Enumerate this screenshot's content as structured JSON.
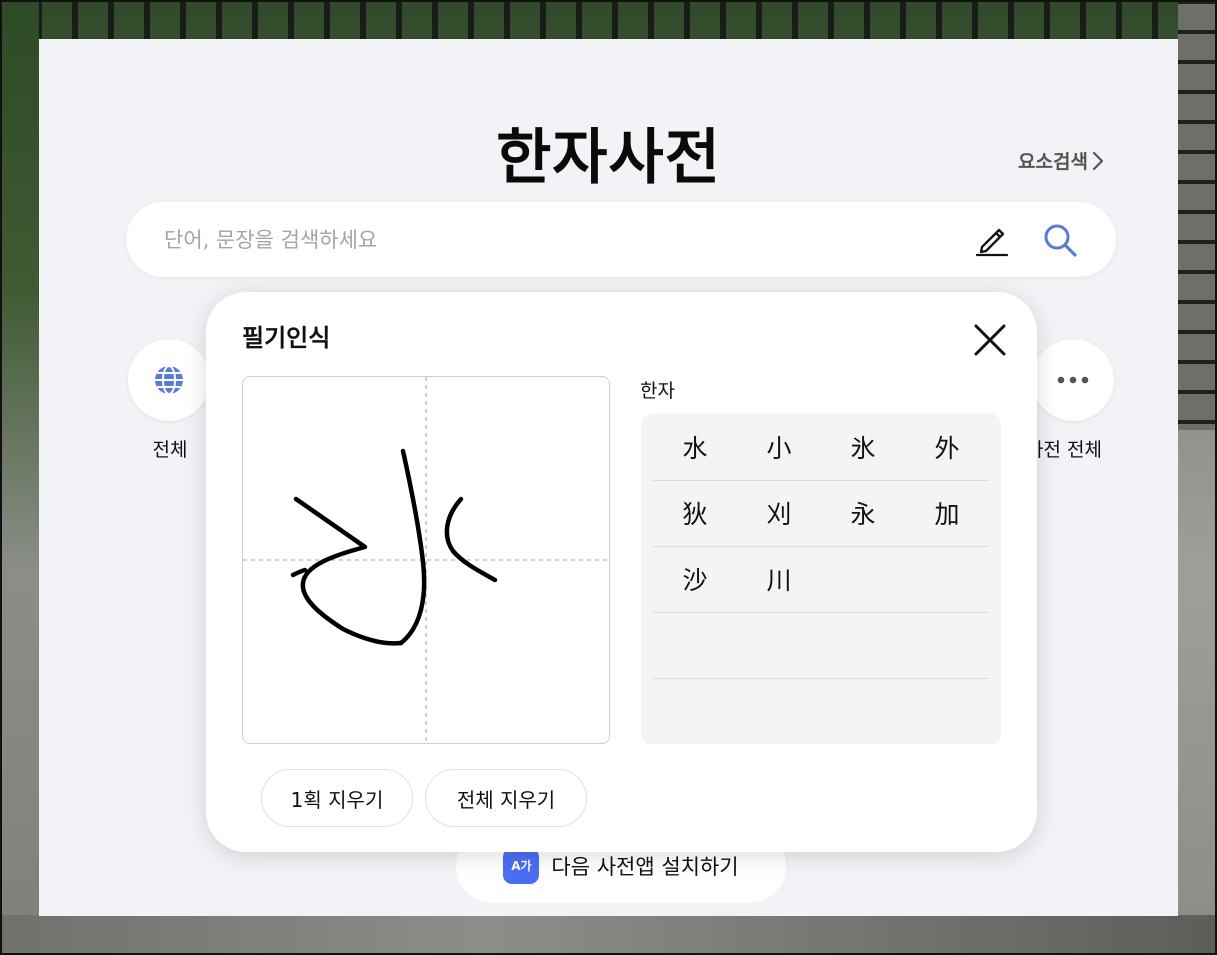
{
  "page": {
    "title": "한자사전",
    "element_search_label": "요소검색",
    "search": {
      "placeholder": "단어, 문장을 검색하세요",
      "value": ""
    },
    "categories": [
      {
        "label": "전체",
        "icon": "globe-icon"
      },
      {
        "label": "사전 전체",
        "icon": "more-icon"
      }
    ],
    "install_app": {
      "icon_text": "A가",
      "label": "다음 사전앱 설치하기"
    }
  },
  "handwriting": {
    "title": "필기인식",
    "results_label": "한자",
    "results": [
      [
        "水",
        "小",
        "氷",
        "外"
      ],
      [
        "狄",
        "刈",
        "永",
        "加"
      ],
      [
        "沙",
        "川",
        "",
        ""
      ],
      [
        "",
        "",
        "",
        ""
      ],
      [
        "",
        "",
        "",
        ""
      ]
    ],
    "undo_label": "1획 지우기",
    "clear_label": "전체 지우기"
  },
  "colors": {
    "accent": "#4c6ef5",
    "icon_blue": "#5a7bd8",
    "page_bg": "#f2f3f6"
  }
}
